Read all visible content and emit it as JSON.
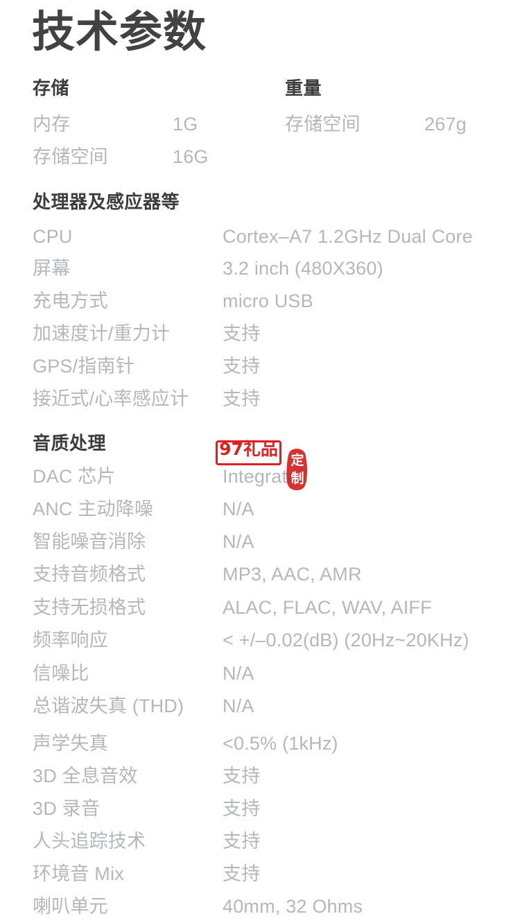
{
  "page": {
    "title": "技术参数",
    "background_color": "#ffffff",
    "title_color": "#424242",
    "label_color": "#b4b7bb",
    "header_color": "#3c3c3c"
  },
  "sections": [
    {
      "key": "storage",
      "header": "存储",
      "rows": [
        {
          "label": "内存",
          "value": "1G"
        },
        {
          "label": "存储空间",
          "value": "16G"
        }
      ]
    },
    {
      "key": "weight",
      "header": "重量",
      "rows": [
        {
          "label": "存储空间",
          "value": "267g"
        }
      ]
    },
    {
      "key": "processor",
      "header": "处理器及感应器等",
      "rows": [
        {
          "label": "CPU",
          "value": "Cortex–A7 1.2GHz Dual Core"
        },
        {
          "label": "屏幕",
          "value": "3.2 inch (480X360)"
        },
        {
          "label": "充电方式",
          "value": "micro USB"
        },
        {
          "label": "加速度计/重力计",
          "value": "支持"
        },
        {
          "label": "GPS/指南针",
          "value": "支持"
        },
        {
          "label": "接近式/心率感应计",
          "value": "支持"
        }
      ]
    },
    {
      "key": "audio",
      "header": "音质处理",
      "rows": [
        {
          "label": "DAC 芯片",
          "value": "Integrated"
        },
        {
          "label": "ANC 主动降噪",
          "value": "N/A"
        },
        {
          "label": "智能噪音消除",
          "value": "N/A"
        },
        {
          "label": "支持音频格式",
          "value": "MP3, AAC, AMR"
        },
        {
          "label": "支持无损格式",
          "value": "ALAC, FLAC, WAV, AIFF"
        },
        {
          "label": "频率响应",
          "value": "< +/–0.02(dB) (20Hz~20KHz)"
        },
        {
          "label": "信噪比",
          "value": "N/A"
        },
        {
          "label": "总谐波失真 (THD)",
          "value": "N/A"
        },
        {
          "label": "声学失真",
          "value": "<0.5% (1kHz)"
        },
        {
          "label": "3D 全息音效",
          "value": "支持"
        },
        {
          "label": "3D 录音",
          "value": "支持"
        },
        {
          "label": "人头追踪技术",
          "value": "支持"
        },
        {
          "label": "环境音 Mix",
          "value": "支持"
        },
        {
          "label": "喇叭单元",
          "value": "40mm, 32 Ohms"
        }
      ]
    }
  ],
  "watermark": {
    "box_text": "97礼品",
    "seal_text_top": "定",
    "seal_text_bottom": "制",
    "color": "#e02020"
  }
}
